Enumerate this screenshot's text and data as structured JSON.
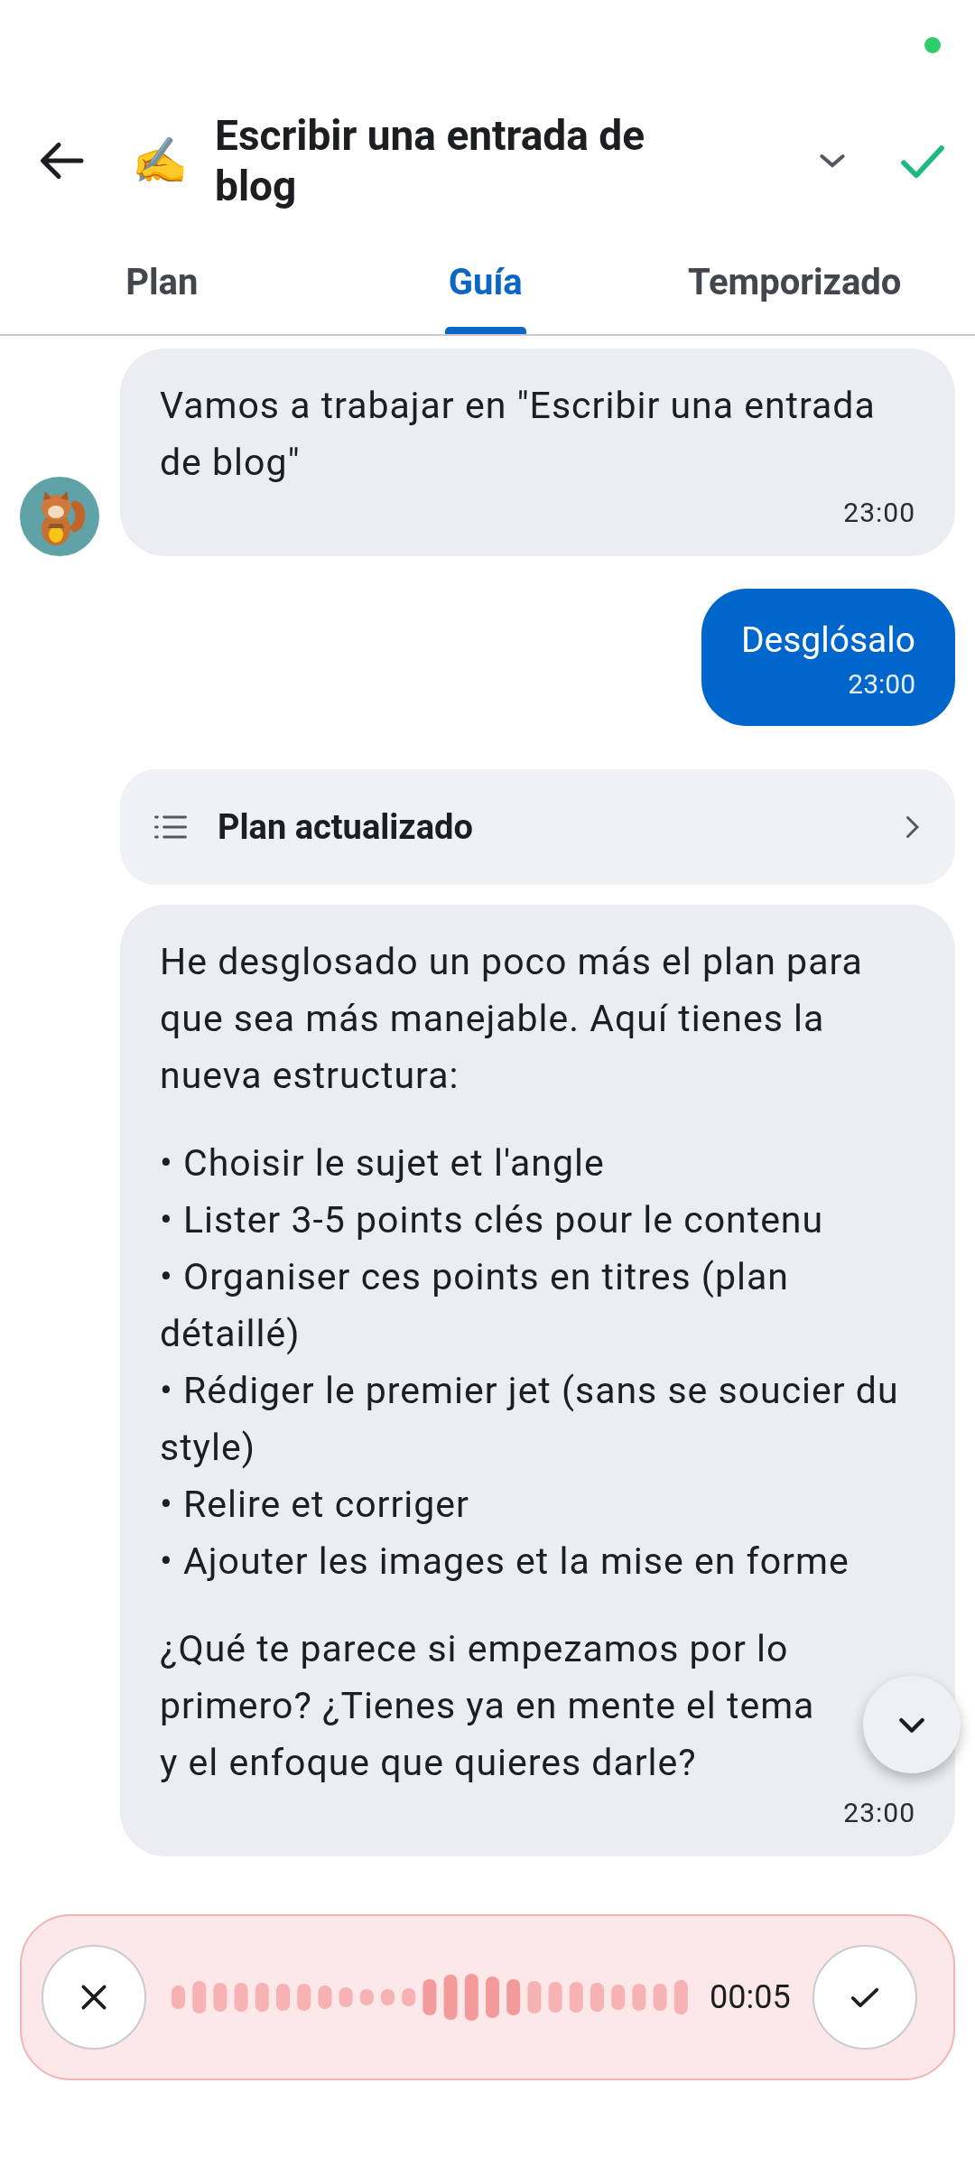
{
  "header": {
    "emoji": "✍️",
    "title": "Escribir una entrada de blog"
  },
  "tabs": [
    {
      "label": "Plan",
      "selected": false
    },
    {
      "label": "Guía",
      "selected": true
    },
    {
      "label": "Temporizado",
      "selected": false
    }
  ],
  "messages": [
    {
      "kind": "bot",
      "text": "Vamos a trabajar en \"Escribir una entrada de blog\"",
      "time": "23:00",
      "avatar": true
    },
    {
      "kind": "user",
      "text": "Desglósalo",
      "time": "23:00"
    },
    {
      "kind": "card",
      "text": "Plan actualizado"
    },
    {
      "kind": "bot",
      "intro": "He desglosado un poco más el plan para que sea más manejable. Aquí tienes la nueva estructura:",
      "bullets": [
        "• Choisir le sujet et l'angle",
        "• Lister 3-5 points clés pour le contenu",
        "• Organiser ces points en titres (plan détaillé)",
        "• Rédiger le premier jet (sans se soucier du style)",
        "• Relire et corriger",
        "• Ajouter les images et la mise en forme"
      ],
      "outro": "¿Qué te parece si empezamos por lo primero? ¿Tienes ya en mente el tema y el enfoque que quieres darle?",
      "time": "23:00",
      "avatar": false
    }
  ],
  "recorder": {
    "duration": "00:05"
  }
}
